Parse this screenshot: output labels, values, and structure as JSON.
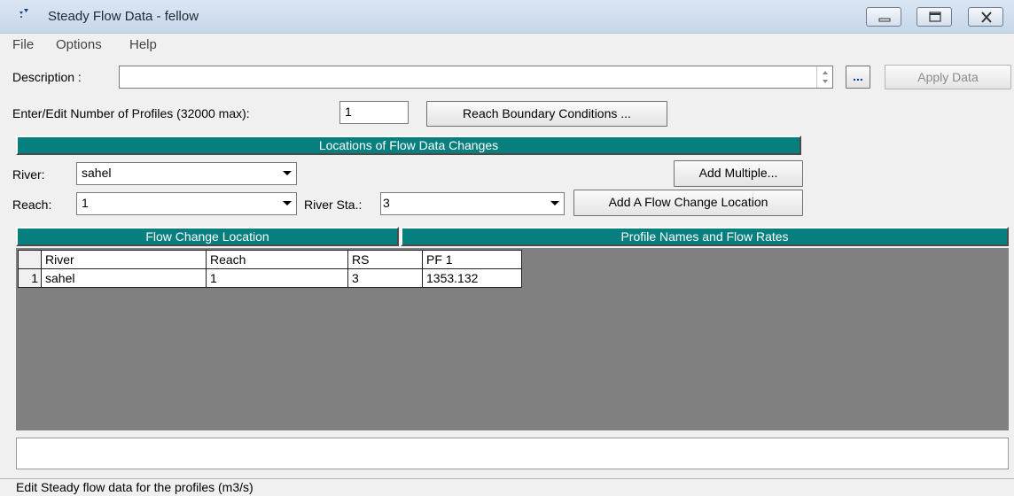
{
  "window": {
    "title": "Steady Flow Data - fellow"
  },
  "menu": {
    "items": [
      "File",
      "Options",
      "Help"
    ]
  },
  "description": {
    "label": "Description :",
    "value": "",
    "browse_label": "...",
    "apply_label": "Apply Data"
  },
  "profiles": {
    "label": "Enter/Edit Number of Profiles (32000 max):",
    "value": "1",
    "reach_boundary_label": "Reach Boundary Conditions ..."
  },
  "locations": {
    "header": "Locations of Flow Data Changes",
    "river_label": "River:",
    "river_value": "sahel",
    "reach_label": "Reach:",
    "reach_value": "1",
    "river_sta_label": "River Sta.:",
    "river_sta_value": "3",
    "add_multiple_label": "Add Multiple...",
    "add_flow_change_label": "Add A Flow Change Location"
  },
  "table": {
    "left_header": "Flow Change Location",
    "right_header": "Profile Names and Flow Rates",
    "columns": [
      "River",
      "Reach",
      "RS",
      "PF 1"
    ],
    "rows": [
      {
        "num": "1",
        "river": "sahel",
        "reach": "1",
        "rs": "3",
        "pf1": "1353.132"
      }
    ]
  },
  "status": {
    "text": "Edit Steady flow data for the profiles (m3/s)"
  },
  "colors": {
    "accent": "#077f7f",
    "grid_bg": "#808080"
  }
}
